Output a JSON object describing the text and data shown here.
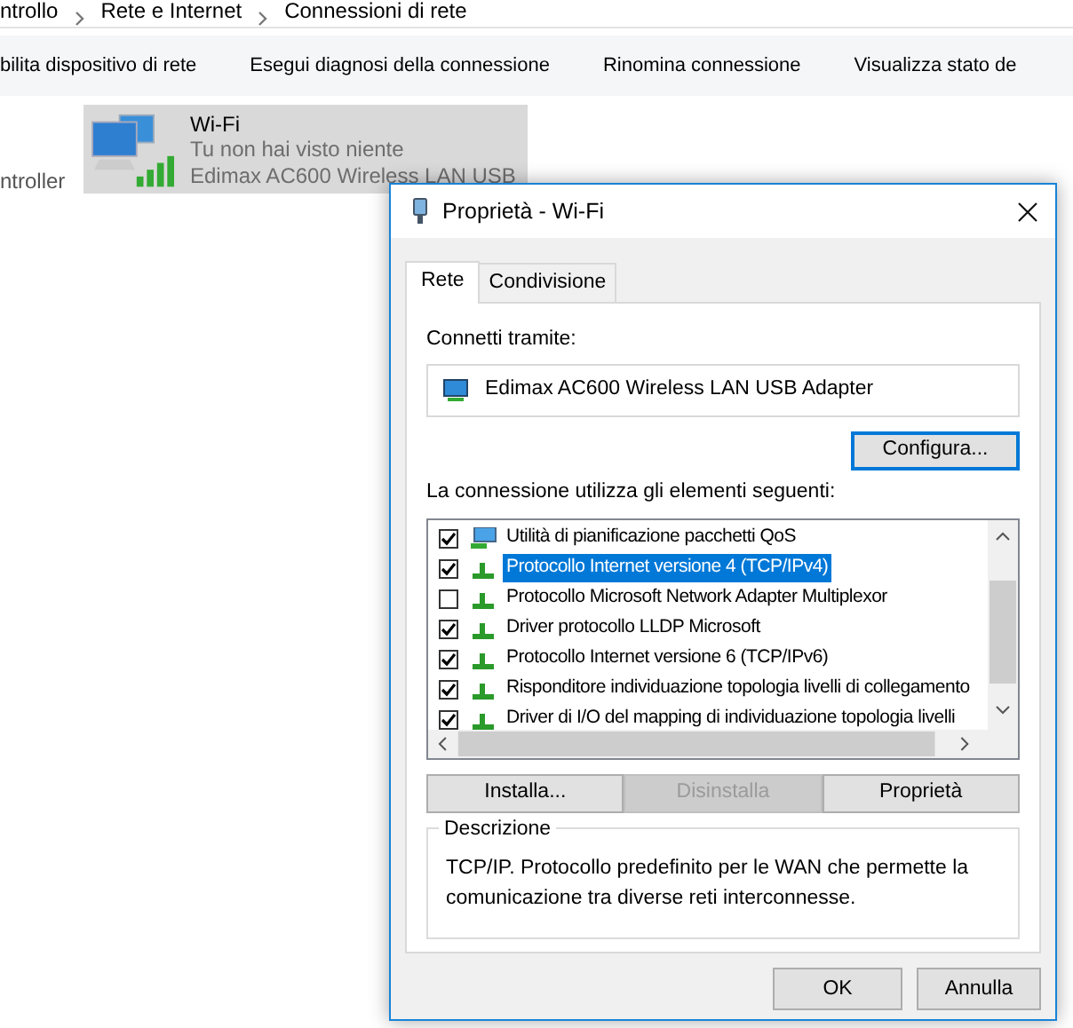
{
  "explorer": {
    "breadcrumb": [
      "ntrollo",
      "Rete e Internet",
      "Connessioni di rete"
    ],
    "toolbar": [
      "bilita dispositivo di rete",
      "Esegui diagnosi della connessione",
      "Rinomina connessione",
      "Visualizza stato de"
    ],
    "sidebar_text": "ntroller",
    "connection": {
      "name": "Wi-Fi",
      "status": "Tu non hai visto niente",
      "adapter": "Edimax AC600 Wireless LAN USB",
      "selected": true
    }
  },
  "dialog": {
    "title": "Proprietà - Wi-Fi",
    "tabs": [
      {
        "label": "Rete",
        "selected": true
      },
      {
        "label": "Condivisione",
        "selected": false
      }
    ],
    "connect_using_label": "Connetti tramite:",
    "adapter": "Edimax AC600 Wireless LAN USB Adapter",
    "configure_button": "Configura...",
    "items_label": "La connessione utilizza gli elementi seguenti:",
    "items": [
      {
        "kind": "service",
        "label": "Utilità di pianificazione pacchetti QoS",
        "checked": true,
        "selected": false
      },
      {
        "kind": "protocol",
        "label": "Protocollo Internet versione 4 (TCP/IPv4)",
        "checked": true,
        "selected": true
      },
      {
        "kind": "protocol",
        "label": "Protocollo Microsoft Network Adapter Multiplexor",
        "checked": false,
        "selected": false
      },
      {
        "kind": "protocol",
        "label": "Driver protocollo LLDP Microsoft",
        "checked": true,
        "selected": false
      },
      {
        "kind": "protocol",
        "label": "Protocollo Internet versione 6 (TCP/IPv6)",
        "checked": true,
        "selected": false
      },
      {
        "kind": "protocol",
        "label": "Risponditore individuazione topologia livelli di collegamento",
        "checked": true,
        "selected": false
      },
      {
        "kind": "protocol",
        "label": "Driver di I/O del mapping di individuazione topologia livelli",
        "checked": true,
        "selected": false
      }
    ],
    "buttons": [
      {
        "label": "Installa...",
        "disabled": false
      },
      {
        "label": "Disinstalla",
        "disabled": true
      },
      {
        "label": "Proprietà",
        "disabled": false
      }
    ],
    "description": {
      "legend": "Descrizione",
      "text": "TCP/IP. Protocollo predefinito per le WAN che permette la comunicazione tra diverse reti interconnesse."
    },
    "footer_buttons": [
      "OK",
      "Annulla"
    ]
  }
}
